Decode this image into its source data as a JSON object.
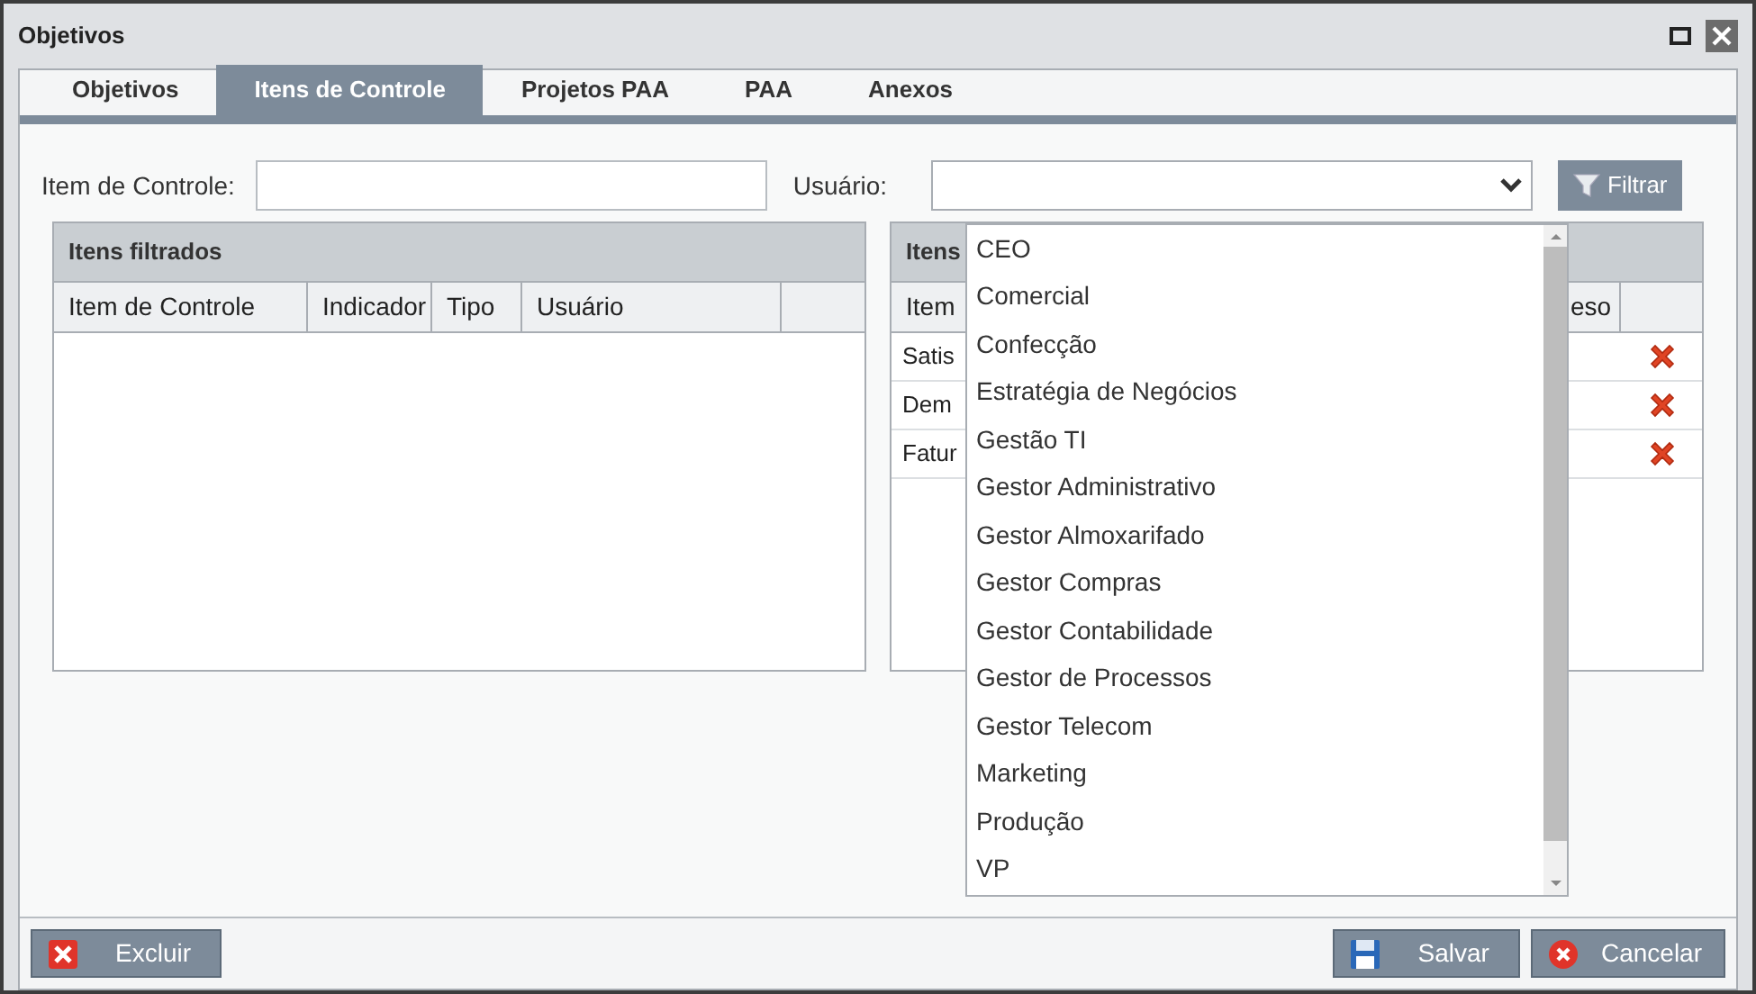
{
  "window": {
    "title": "Objetivos"
  },
  "tabs": [
    {
      "label": "Objetivos",
      "selected": false
    },
    {
      "label": "Itens de Controle",
      "selected": true
    },
    {
      "label": "Projetos PAA",
      "selected": false
    },
    {
      "label": "PAA",
      "selected": false
    },
    {
      "label": "Anexos",
      "selected": false
    }
  ],
  "filters": {
    "item_label": "Item de Controle:",
    "user_label": "Usuário:",
    "filter_button": "Filtrar"
  },
  "user_dropdown": {
    "expanded": true,
    "options": [
      "CEO",
      "Comercial",
      "Confecção",
      "Estratégia de Negócios",
      "Gestão TI",
      "Gestor Administrativo",
      "Gestor Almoxarifado",
      "Gestor Compras",
      "Gestor Contabilidade",
      "Gestor de Processos",
      "Gestor Telecom",
      "Marketing",
      "Produção",
      "VP"
    ]
  },
  "left_panel": {
    "title": "Itens filtrados",
    "columns": [
      "Item de Controle",
      "Indicador",
      "Tipo",
      "Usuário"
    ]
  },
  "right_panel": {
    "title": "Itens",
    "columns": [
      "Item",
      "eso"
    ],
    "rows": [
      {
        "column_1": "Satis"
      },
      {
        "column_1": "Dem"
      },
      {
        "column_1": "Fatur"
      }
    ]
  },
  "footer_buttons": [
    {
      "kind": "delete",
      "label": "Excluir"
    },
    {
      "kind": "save",
      "label": "Salvar"
    },
    {
      "kind": "cancel",
      "label": "Cancelar"
    }
  ]
}
